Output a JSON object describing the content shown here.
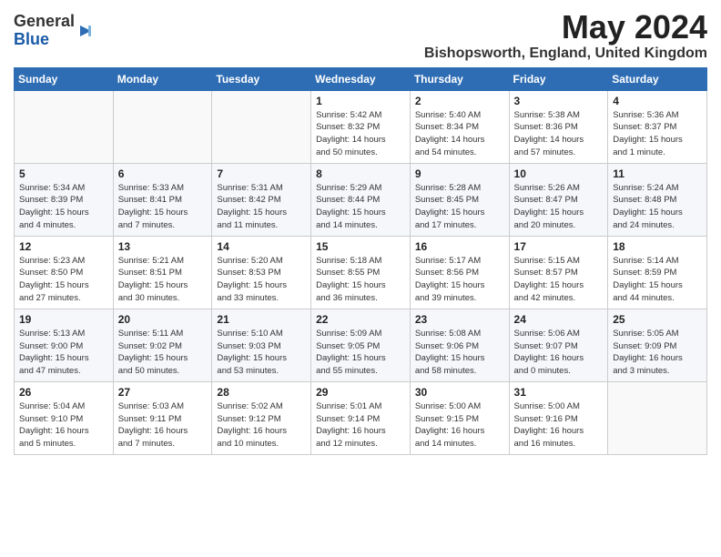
{
  "logo": {
    "general": "General",
    "blue": "Blue"
  },
  "title": "May 2024",
  "location": "Bishopsworth, England, United Kingdom",
  "days_of_week": [
    "Sunday",
    "Monday",
    "Tuesday",
    "Wednesday",
    "Thursday",
    "Friday",
    "Saturday"
  ],
  "weeks": [
    [
      {
        "day": "",
        "info": ""
      },
      {
        "day": "",
        "info": ""
      },
      {
        "day": "",
        "info": ""
      },
      {
        "day": "1",
        "info": "Sunrise: 5:42 AM\nSunset: 8:32 PM\nDaylight: 14 hours\nand 50 minutes."
      },
      {
        "day": "2",
        "info": "Sunrise: 5:40 AM\nSunset: 8:34 PM\nDaylight: 14 hours\nand 54 minutes."
      },
      {
        "day": "3",
        "info": "Sunrise: 5:38 AM\nSunset: 8:36 PM\nDaylight: 14 hours\nand 57 minutes."
      },
      {
        "day": "4",
        "info": "Sunrise: 5:36 AM\nSunset: 8:37 PM\nDaylight: 15 hours\nand 1 minute."
      }
    ],
    [
      {
        "day": "5",
        "info": "Sunrise: 5:34 AM\nSunset: 8:39 PM\nDaylight: 15 hours\nand 4 minutes."
      },
      {
        "day": "6",
        "info": "Sunrise: 5:33 AM\nSunset: 8:41 PM\nDaylight: 15 hours\nand 7 minutes."
      },
      {
        "day": "7",
        "info": "Sunrise: 5:31 AM\nSunset: 8:42 PM\nDaylight: 15 hours\nand 11 minutes."
      },
      {
        "day": "8",
        "info": "Sunrise: 5:29 AM\nSunset: 8:44 PM\nDaylight: 15 hours\nand 14 minutes."
      },
      {
        "day": "9",
        "info": "Sunrise: 5:28 AM\nSunset: 8:45 PM\nDaylight: 15 hours\nand 17 minutes."
      },
      {
        "day": "10",
        "info": "Sunrise: 5:26 AM\nSunset: 8:47 PM\nDaylight: 15 hours\nand 20 minutes."
      },
      {
        "day": "11",
        "info": "Sunrise: 5:24 AM\nSunset: 8:48 PM\nDaylight: 15 hours\nand 24 minutes."
      }
    ],
    [
      {
        "day": "12",
        "info": "Sunrise: 5:23 AM\nSunset: 8:50 PM\nDaylight: 15 hours\nand 27 minutes."
      },
      {
        "day": "13",
        "info": "Sunrise: 5:21 AM\nSunset: 8:51 PM\nDaylight: 15 hours\nand 30 minutes."
      },
      {
        "day": "14",
        "info": "Sunrise: 5:20 AM\nSunset: 8:53 PM\nDaylight: 15 hours\nand 33 minutes."
      },
      {
        "day": "15",
        "info": "Sunrise: 5:18 AM\nSunset: 8:55 PM\nDaylight: 15 hours\nand 36 minutes."
      },
      {
        "day": "16",
        "info": "Sunrise: 5:17 AM\nSunset: 8:56 PM\nDaylight: 15 hours\nand 39 minutes."
      },
      {
        "day": "17",
        "info": "Sunrise: 5:15 AM\nSunset: 8:57 PM\nDaylight: 15 hours\nand 42 minutes."
      },
      {
        "day": "18",
        "info": "Sunrise: 5:14 AM\nSunset: 8:59 PM\nDaylight: 15 hours\nand 44 minutes."
      }
    ],
    [
      {
        "day": "19",
        "info": "Sunrise: 5:13 AM\nSunset: 9:00 PM\nDaylight: 15 hours\nand 47 minutes."
      },
      {
        "day": "20",
        "info": "Sunrise: 5:11 AM\nSunset: 9:02 PM\nDaylight: 15 hours\nand 50 minutes."
      },
      {
        "day": "21",
        "info": "Sunrise: 5:10 AM\nSunset: 9:03 PM\nDaylight: 15 hours\nand 53 minutes."
      },
      {
        "day": "22",
        "info": "Sunrise: 5:09 AM\nSunset: 9:05 PM\nDaylight: 15 hours\nand 55 minutes."
      },
      {
        "day": "23",
        "info": "Sunrise: 5:08 AM\nSunset: 9:06 PM\nDaylight: 15 hours\nand 58 minutes."
      },
      {
        "day": "24",
        "info": "Sunrise: 5:06 AM\nSunset: 9:07 PM\nDaylight: 16 hours\nand 0 minutes."
      },
      {
        "day": "25",
        "info": "Sunrise: 5:05 AM\nSunset: 9:09 PM\nDaylight: 16 hours\nand 3 minutes."
      }
    ],
    [
      {
        "day": "26",
        "info": "Sunrise: 5:04 AM\nSunset: 9:10 PM\nDaylight: 16 hours\nand 5 minutes."
      },
      {
        "day": "27",
        "info": "Sunrise: 5:03 AM\nSunset: 9:11 PM\nDaylight: 16 hours\nand 7 minutes."
      },
      {
        "day": "28",
        "info": "Sunrise: 5:02 AM\nSunset: 9:12 PM\nDaylight: 16 hours\nand 10 minutes."
      },
      {
        "day": "29",
        "info": "Sunrise: 5:01 AM\nSunset: 9:14 PM\nDaylight: 16 hours\nand 12 minutes."
      },
      {
        "day": "30",
        "info": "Sunrise: 5:00 AM\nSunset: 9:15 PM\nDaylight: 16 hours\nand 14 minutes."
      },
      {
        "day": "31",
        "info": "Sunrise: 5:00 AM\nSunset: 9:16 PM\nDaylight: 16 hours\nand 16 minutes."
      },
      {
        "day": "",
        "info": ""
      }
    ]
  ]
}
